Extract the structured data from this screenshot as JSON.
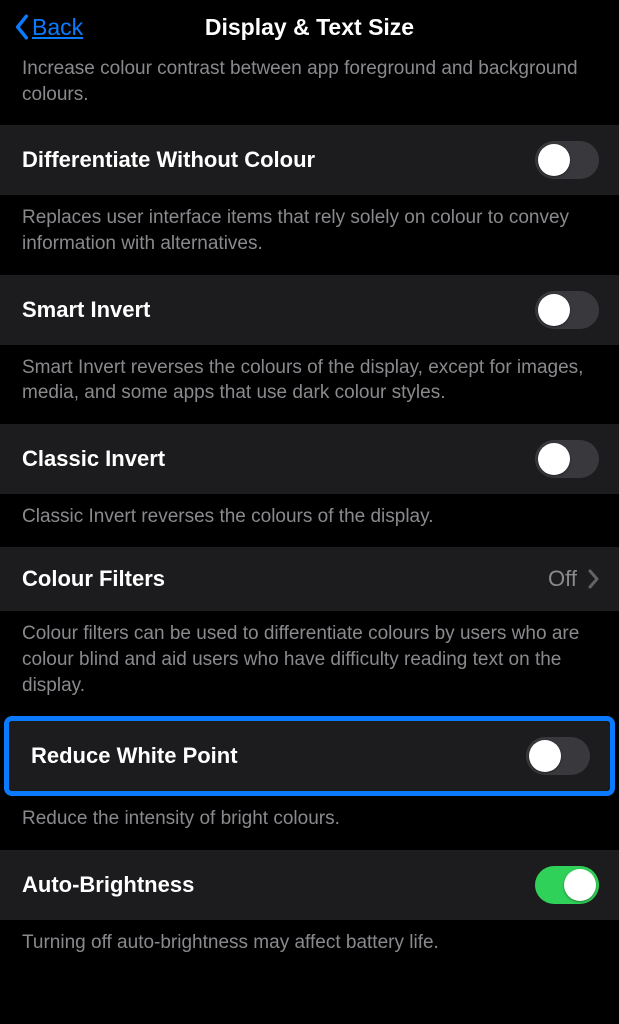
{
  "nav": {
    "back": "Back",
    "title": "Display & Text Size"
  },
  "items": [
    {
      "label": "",
      "desc": "Increase colour contrast between app foreground and background colours.",
      "type": "desc-only"
    },
    {
      "label": "Differentiate Without Colour",
      "desc": "Replaces user interface items that rely solely on colour to convey information with alternatives.",
      "type": "toggle",
      "on": false
    },
    {
      "label": "Smart Invert",
      "desc": "Smart Invert reverses the colours of the display, except for images, media, and some apps that use dark colour styles.",
      "type": "toggle",
      "on": false
    },
    {
      "label": "Classic Invert",
      "desc": "Classic Invert reverses the colours of the display.",
      "type": "toggle",
      "on": false
    },
    {
      "label": "Colour Filters",
      "value": "Off",
      "desc": "Colour filters can be used to differentiate colours by users who are colour blind and aid users who have difficulty reading text on the display.",
      "type": "link"
    },
    {
      "label": "Reduce White Point",
      "desc": "Reduce the intensity of bright colours.",
      "type": "toggle",
      "on": false,
      "highlight": true
    },
    {
      "label": "Auto-Brightness",
      "desc": "Turning off auto-brightness may affect battery life.",
      "type": "toggle",
      "on": true
    }
  ]
}
